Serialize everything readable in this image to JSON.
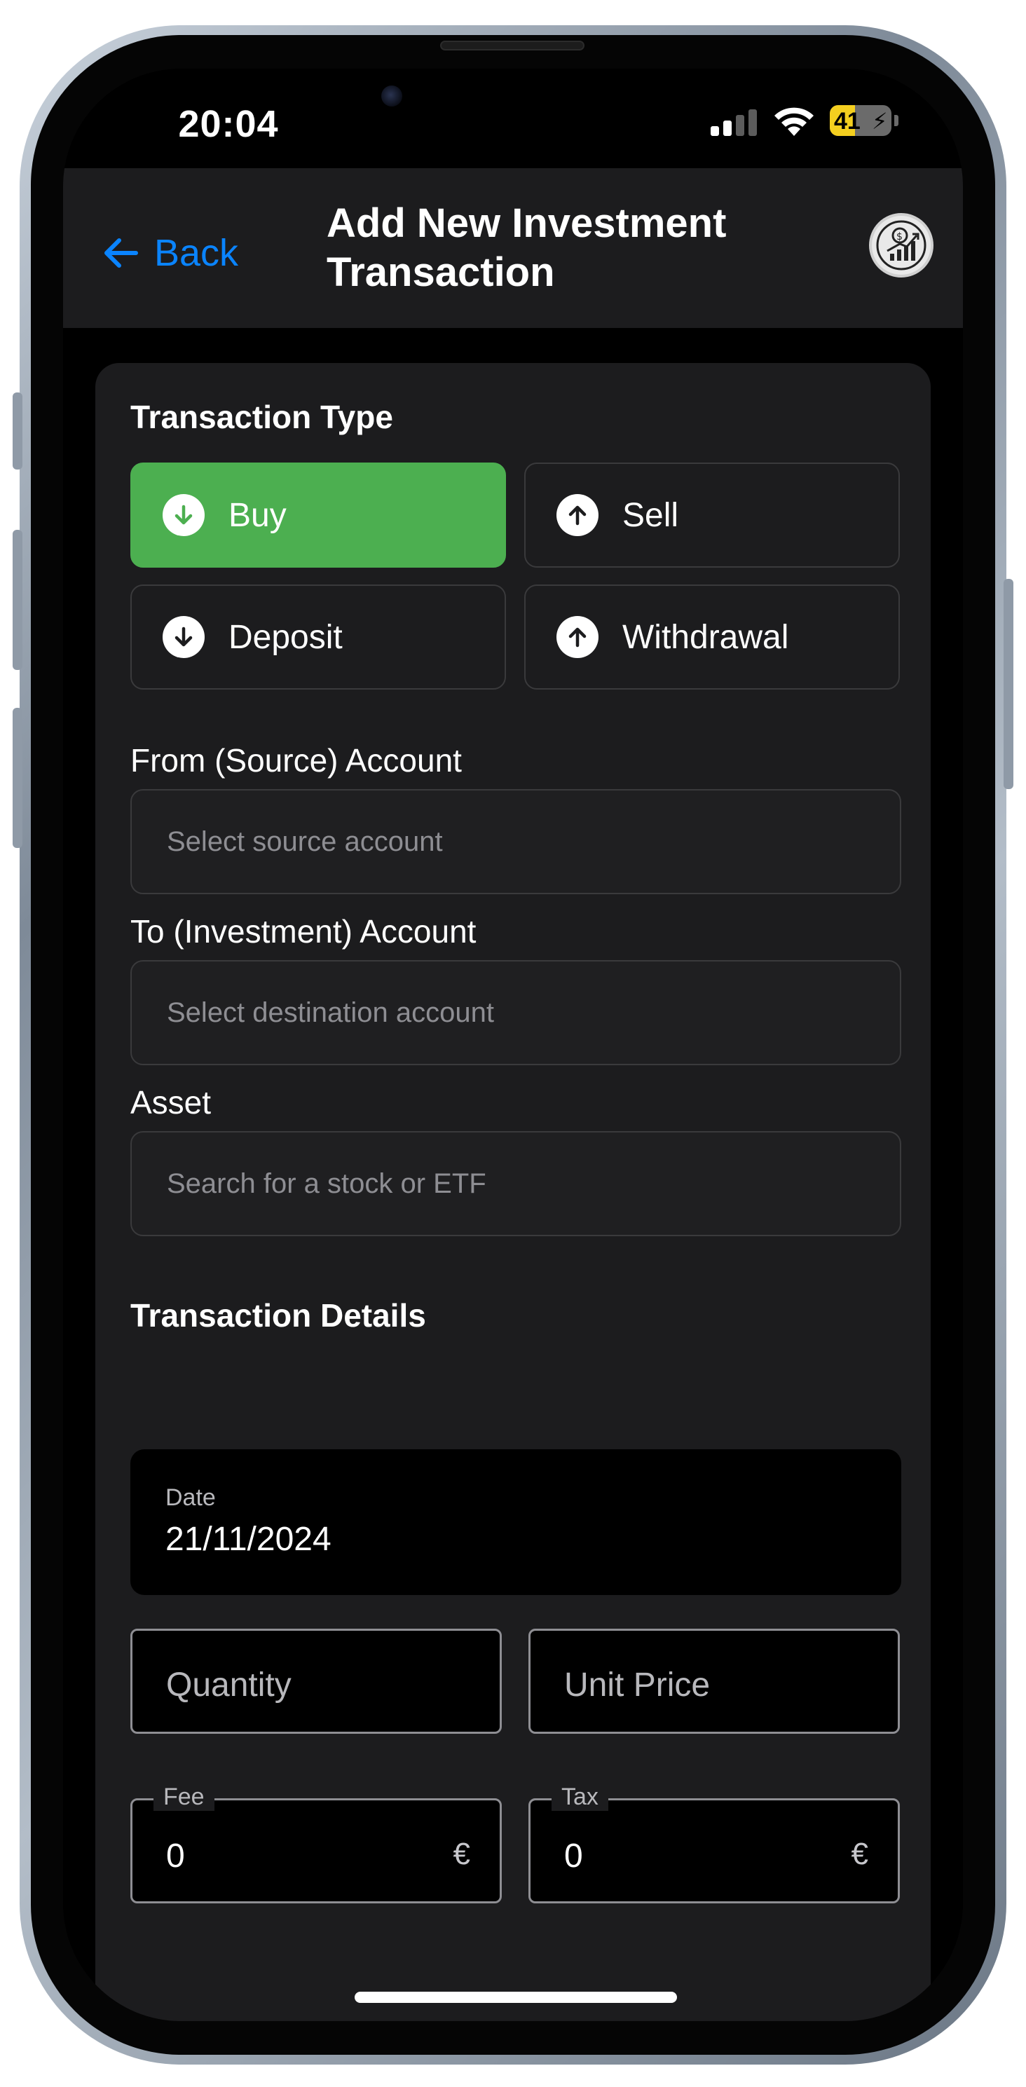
{
  "status_bar": {
    "time": "20:04",
    "battery_level": "41",
    "icons": [
      "cellular-signal-icon",
      "wifi-icon",
      "battery-charging-icon"
    ]
  },
  "header": {
    "back_label": "Back",
    "title": "Add New Investment Transaction",
    "logo_icon": "investment-chart-logo-icon"
  },
  "transaction_type": {
    "section_title": "Transaction Type",
    "options": [
      {
        "label": "Buy",
        "icon": "arrow-down-circle-icon",
        "selected": true
      },
      {
        "label": "Sell",
        "icon": "arrow-up-circle-icon",
        "selected": false
      },
      {
        "label": "Deposit",
        "icon": "arrow-down-circle-icon",
        "selected": false
      },
      {
        "label": "Withdrawal",
        "icon": "arrow-up-circle-icon",
        "selected": false
      }
    ]
  },
  "source_account": {
    "label": "From (Source) Account",
    "placeholder": "Select source account"
  },
  "destination_account": {
    "label": "To (Investment) Account",
    "placeholder": "Select destination account"
  },
  "asset": {
    "label": "Asset",
    "placeholder": "Search for a stock or ETF"
  },
  "details": {
    "section_title": "Transaction Details",
    "date_label": "Date",
    "date_value": "21/11/2024",
    "quantity_placeholder": "Quantity",
    "unit_price_placeholder": "Unit Price",
    "fee_label": "Fee",
    "fee_value": "0",
    "fee_currency": "€",
    "tax_label": "Tax",
    "tax_value": "0",
    "tax_currency": "€"
  },
  "colors": {
    "accent_blue": "#0a84ff",
    "buy_green": "#4caf50",
    "background": "#000000",
    "card": "#1c1c1e"
  }
}
